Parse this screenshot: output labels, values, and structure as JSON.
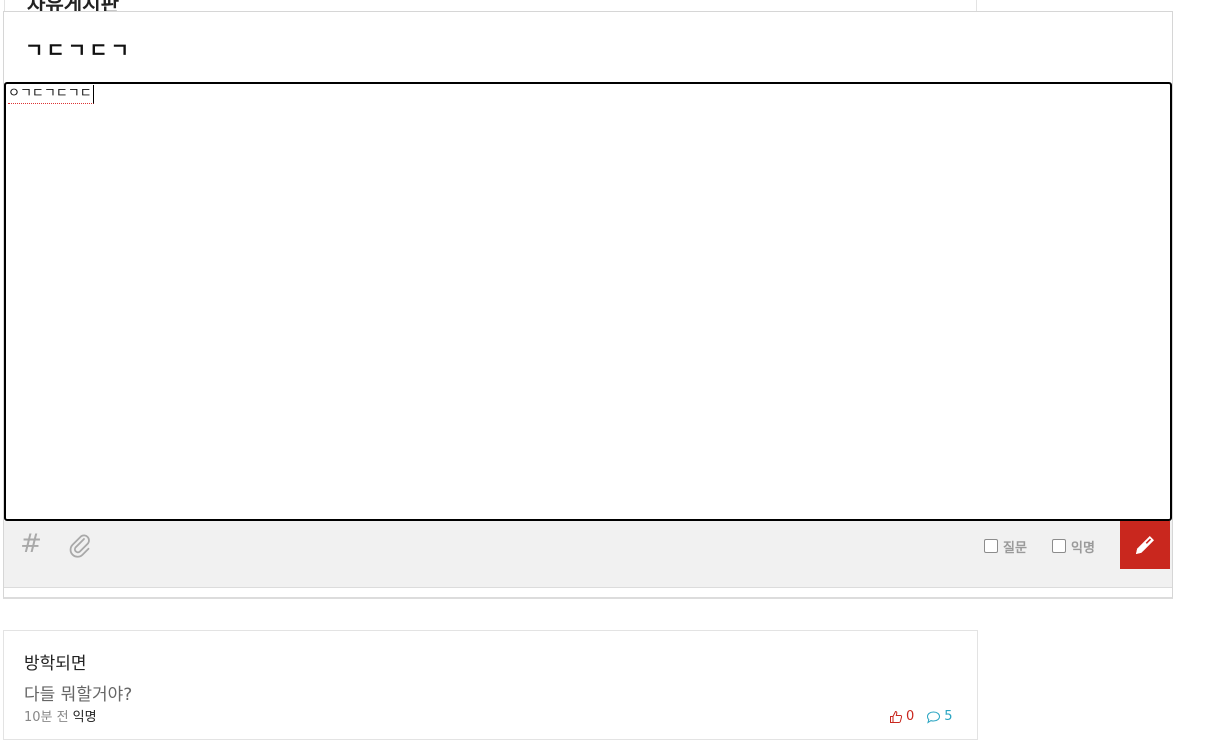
{
  "top_clip": {
    "text": "자유게시판"
  },
  "compose": {
    "title_value": "ㄱㄷㄱㄷㄱ",
    "body_value": "ㅇㄱㄷㄱㄷㄱㄷ",
    "options": {
      "question_label": "질문",
      "anonymous_label": "익명"
    }
  },
  "icons": {
    "hashtag": "#",
    "attach": "paperclip-icon",
    "submit": "pencil-icon",
    "vote": "thumbs-up-icon",
    "comment": "speech-bubble-icon"
  },
  "colors": {
    "accent": "#c9271e",
    "comment": "#2aa5c2",
    "toolbar_bg": "#f1f1f1"
  },
  "article": {
    "title": "방학되면",
    "body": "다들 뭐할거야?",
    "time": "10분 전",
    "author": "익명",
    "votes": "0",
    "comments": "5"
  }
}
